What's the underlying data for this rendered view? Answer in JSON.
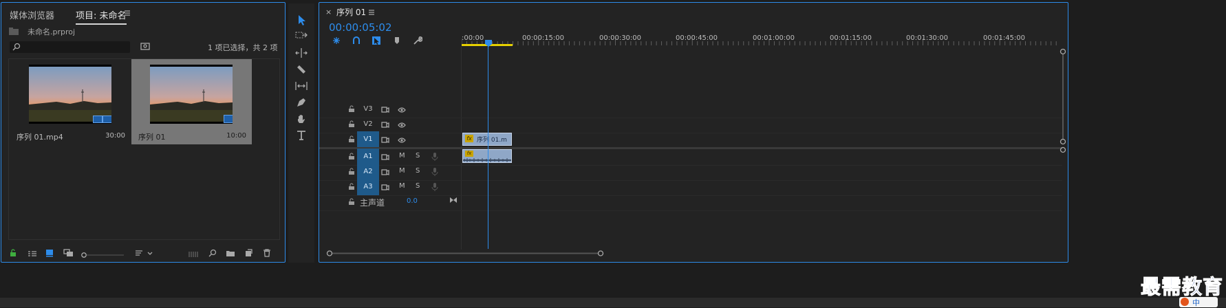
{
  "project_panel": {
    "tab_media_browser": "媒体浏览器",
    "tab_project": "项目: 未命名",
    "project_file": "未命名.prproj",
    "search_placeholder": "",
    "selection_status": "1 项已选择，共 2 项",
    "items": [
      {
        "name": "序列 01.mp4",
        "duration": "30:00",
        "selected": false
      },
      {
        "name": "序列 01",
        "duration": "10:00",
        "selected": true
      }
    ]
  },
  "tools": [
    "selection-tool",
    "track-select-tool",
    "ripple-edit-tool",
    "razor-tool",
    "slip-tool",
    "pen-tool",
    "hand-tool",
    "type-tool"
  ],
  "timeline": {
    "tab_title": "序列 01",
    "close_symbol": "×",
    "timecode": "00:00:05:02",
    "ruler_labels": [
      ":00:00",
      "00:00:15:00",
      "00:00:30:00",
      "00:00:45:00",
      "00:01:00:00",
      "00:01:15:00",
      "00:01:30:00",
      "00:01:45:00"
    ],
    "video_tracks": [
      {
        "id": "V3",
        "targeted": false
      },
      {
        "id": "V2",
        "targeted": false
      },
      {
        "id": "V1",
        "targeted": true
      }
    ],
    "audio_tracks": [
      {
        "id": "A1",
        "targeted": true,
        "m": "M",
        "s": "S"
      },
      {
        "id": "A2",
        "targeted": true,
        "m": "M",
        "s": "S"
      },
      {
        "id": "A3",
        "targeted": true,
        "m": "M",
        "s": "S"
      }
    ],
    "master_label": "主声道",
    "master_value": "0.0",
    "clip_video_label": "序列 01.m",
    "clip_fx": "fx"
  },
  "watermark": {
    "text": "最需教育",
    "ime_text": "中"
  },
  "colors": {
    "accent": "#2d8ceb",
    "panel_bg": "#232323",
    "clip": "#8fa7c7",
    "target_track": "#1f5a8a",
    "work_area": "#e6d000"
  }
}
